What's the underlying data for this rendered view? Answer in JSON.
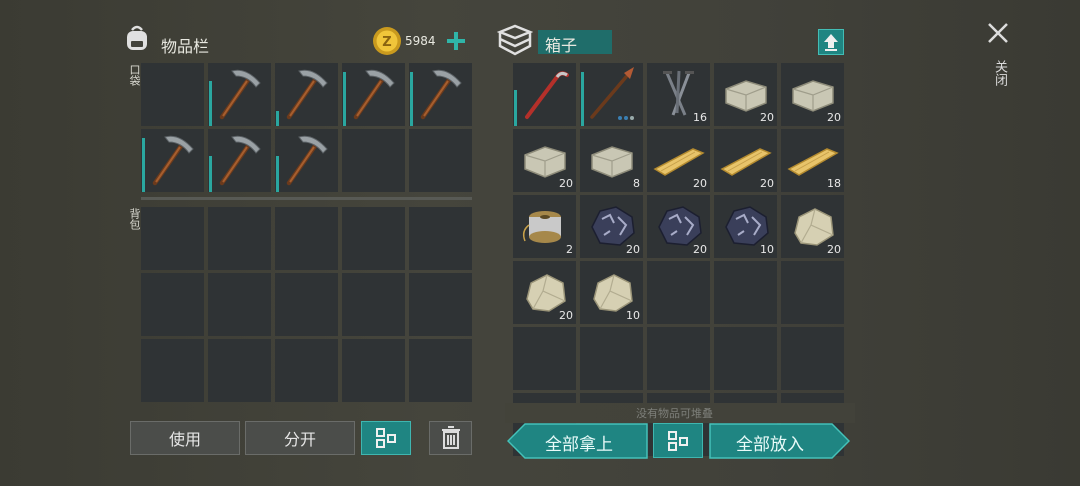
{
  "inventory": {
    "title": "物品栏",
    "coins": "5984",
    "pocket_label": "口袋",
    "backpack_label": "背包"
  },
  "chest": {
    "title": "箱子",
    "footer_hint": "没有物品可堆叠"
  },
  "close": {
    "label": "关闭"
  },
  "buttons": {
    "use": "使用",
    "split": "分开",
    "take_all": "全部拿上",
    "put_all": "全部放入"
  },
  "pocket_items": [
    {
      "icon": "pickaxe-icon",
      "durability": 0.75
    },
    {
      "icon": "pickaxe-icon",
      "durability": 0.25
    },
    {
      "icon": "pickaxe-icon",
      "durability": 0.9
    },
    {
      "icon": "pickaxe-icon",
      "durability": 0.9
    },
    {
      "icon": "pickaxe-icon",
      "durability": 0.9
    },
    {
      "icon": "pickaxe-icon",
      "durability": 0.6
    },
    {
      "icon": "pickaxe-icon",
      "durability": 0.6
    }
  ],
  "chest_items": [
    {
      "icon": "crowbar-icon",
      "count": "",
      "durability": 0.6
    },
    {
      "icon": "spear-icon",
      "count": "",
      "durability": 0.9
    },
    {
      "icon": "nails-icon",
      "count": "16"
    },
    {
      "icon": "stone-brick-icon",
      "count": "20"
    },
    {
      "icon": "stone-brick-icon",
      "count": "20"
    },
    {
      "icon": "stone-brick-icon",
      "count": "20"
    },
    {
      "icon": "stone-brick-icon",
      "count": "8"
    },
    {
      "icon": "wood-plank-icon",
      "count": "20"
    },
    {
      "icon": "wood-plank-icon",
      "count": "20"
    },
    {
      "icon": "wood-plank-icon",
      "count": "18"
    },
    {
      "icon": "wire-spool-icon",
      "count": "2"
    },
    {
      "icon": "iron-ore-icon",
      "count": "20"
    },
    {
      "icon": "iron-ore-icon",
      "count": "20"
    },
    {
      "icon": "iron-ore-icon",
      "count": "10"
    },
    {
      "icon": "stone-icon",
      "count": "20"
    },
    {
      "icon": "stone-icon",
      "count": "20"
    },
    {
      "icon": "stone-icon",
      "count": "10"
    }
  ],
  "colors": {
    "accent": "#1f8582",
    "slot": "#2f3335",
    "durability": "#2aa7a0"
  }
}
